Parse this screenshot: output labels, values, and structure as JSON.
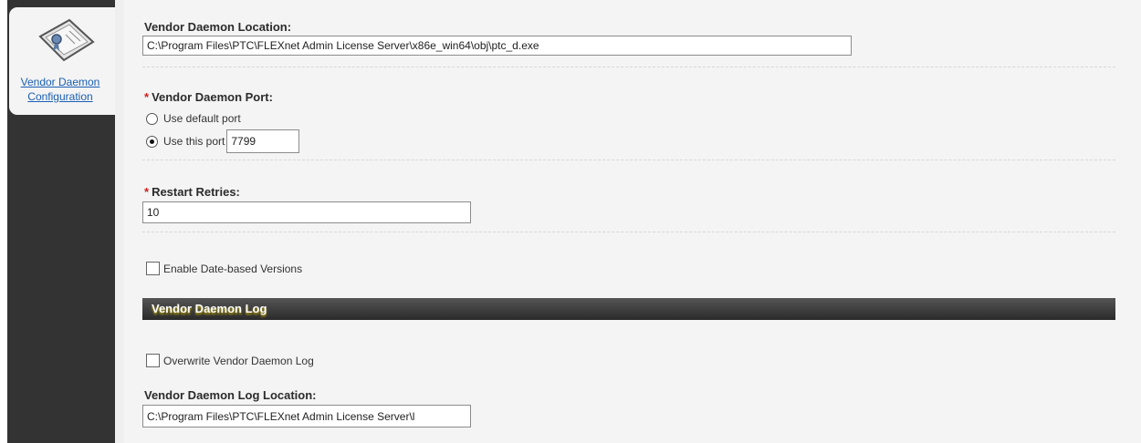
{
  "sidebar": {
    "active_item": {
      "icon": "certificate-icon",
      "label_line1": "Vendor Daemon",
      "label_line2": "Configuration"
    }
  },
  "form": {
    "location": {
      "label": "Vendor Daemon Location:",
      "value": "C:\\Program Files\\PTC\\FLEXnet Admin License Server\\x86e_win64\\obj\\ptc_d.exe"
    },
    "port": {
      "required_mark": "*",
      "label": "Vendor Daemon Port:",
      "option_default": "Use default port",
      "option_custom": "Use this port",
      "selected": "custom",
      "value": "7799"
    },
    "restart_retries": {
      "required_mark": "*",
      "label": "Restart Retries:",
      "value": "10"
    },
    "date_based_versions": {
      "label": "Enable Date-based Versions",
      "checked": false
    },
    "log_section": {
      "title": "Vendor Daemon Log"
    },
    "overwrite_log": {
      "label": "Overwrite Vendor Daemon Log",
      "checked": false
    },
    "log_location": {
      "label": "Vendor Daemon Log Location:",
      "value": "C:\\Program Files\\PTC\\FLEXnet Admin License Server\\l"
    }
  },
  "colors": {
    "sidebar_bg": "#333333",
    "link": "#1a5fb4",
    "required": "#cc2222",
    "section_bar": "#2a2a2a"
  }
}
